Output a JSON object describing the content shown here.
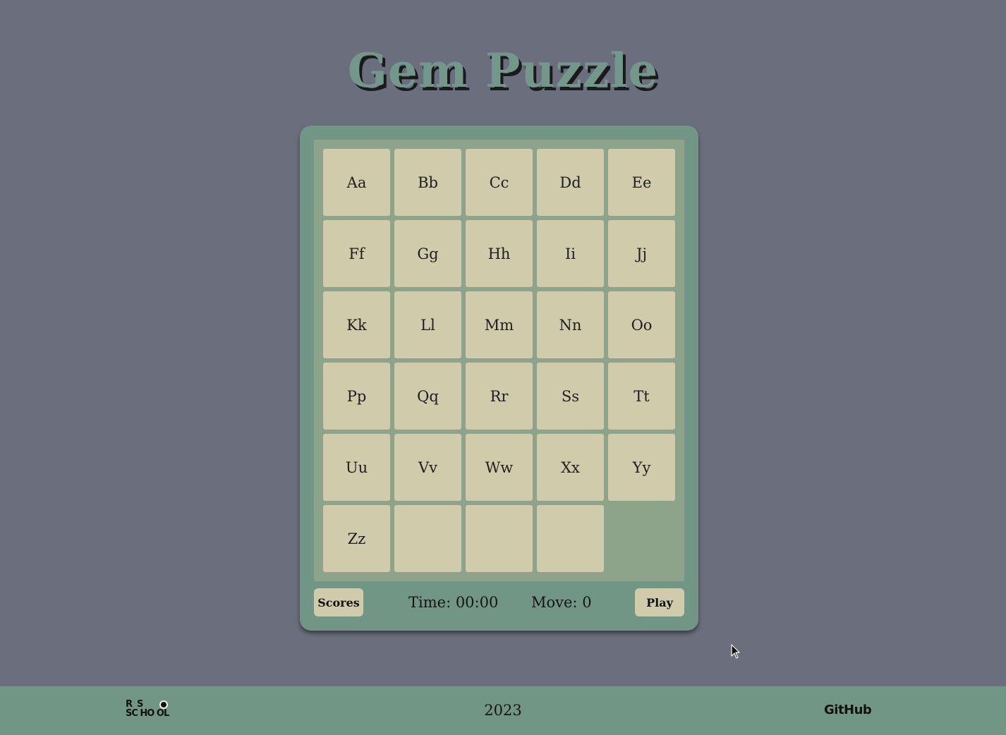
{
  "title": "Gem Puzzle",
  "board": {
    "tiles": [
      "Aa",
      "Bb",
      "Cc",
      "Dd",
      "Ee",
      "Ff",
      "Gg",
      "Hh",
      "Ii",
      "Jj",
      "Kk",
      "Ll",
      "Mm",
      "Nn",
      "Oo",
      "Pp",
      "Qq",
      "Rr",
      "Ss",
      "Tt",
      "Uu",
      "Vv",
      "Ww",
      "Xx",
      "Yy",
      "Zz",
      "",
      "",
      "",
      null
    ]
  },
  "controls": {
    "scores_label": "Scores",
    "time_text": "Time: 00:00",
    "move_text": "Move: 0",
    "play_label": "Play"
  },
  "footer": {
    "logo_row1": "R  S",
    "logo_row2": "SC HO OL",
    "year": "2023",
    "github_label": "GitHub"
  },
  "colors": {
    "background": "#6b6e7d",
    "panel": "#729686",
    "board": "#8da38a",
    "tile": "#d0cbab",
    "title": "#73978a"
  }
}
